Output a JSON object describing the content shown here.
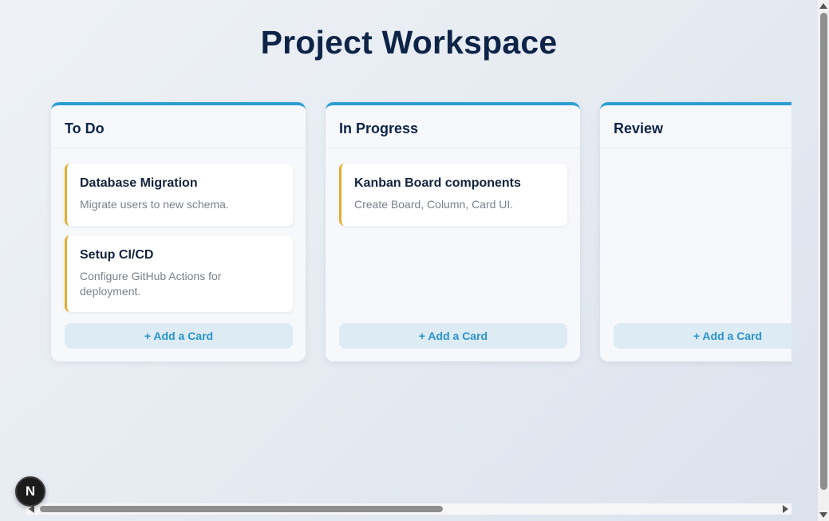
{
  "page": {
    "title": "Project Workspace"
  },
  "columns": [
    {
      "title": "To Do",
      "add_label": "+ Add a Card",
      "cards": [
        {
          "title": "Database Migration",
          "description": "Migrate users to new schema."
        },
        {
          "title": "Setup CI/CD",
          "description": "Configure GitHub Actions for deployment."
        }
      ]
    },
    {
      "title": "In Progress",
      "add_label": "+ Add a Card",
      "cards": [
        {
          "title": "Kanban Board components",
          "description": "Create Board, Column, Card UI."
        }
      ]
    },
    {
      "title": "Review",
      "add_label": "+ Add a Card",
      "cards": []
    }
  ],
  "dev_badge": {
    "label": "N"
  },
  "colors": {
    "accent": "#2b9fd3",
    "card_stripe": "#e5ad2f",
    "title": "#0d2447"
  }
}
